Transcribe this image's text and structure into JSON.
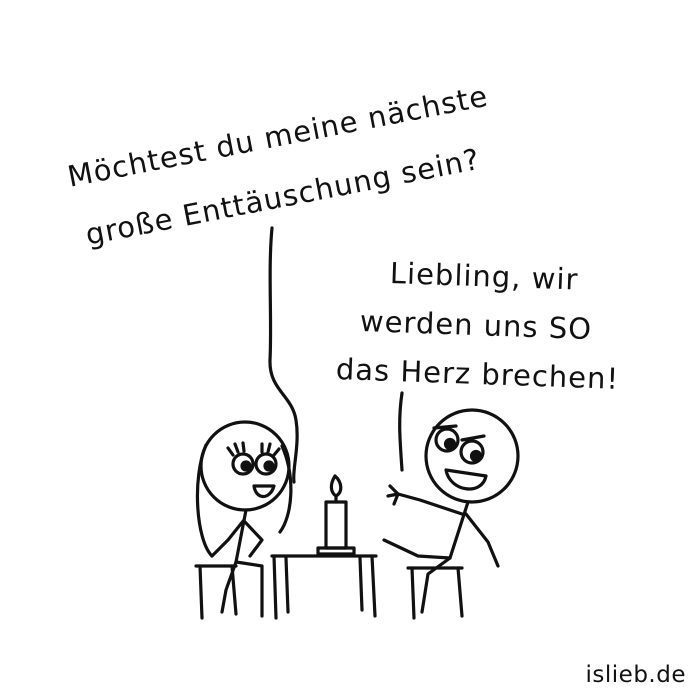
{
  "speech_woman": {
    "line1": "Möchtest du meine nächste",
    "line2": "große Enttäuschung sein?"
  },
  "speech_man": {
    "line1": "Liebling, wir",
    "line2": "werden uns SO",
    "line3": "das Herz brechen!"
  },
  "credit": "islieb.de"
}
